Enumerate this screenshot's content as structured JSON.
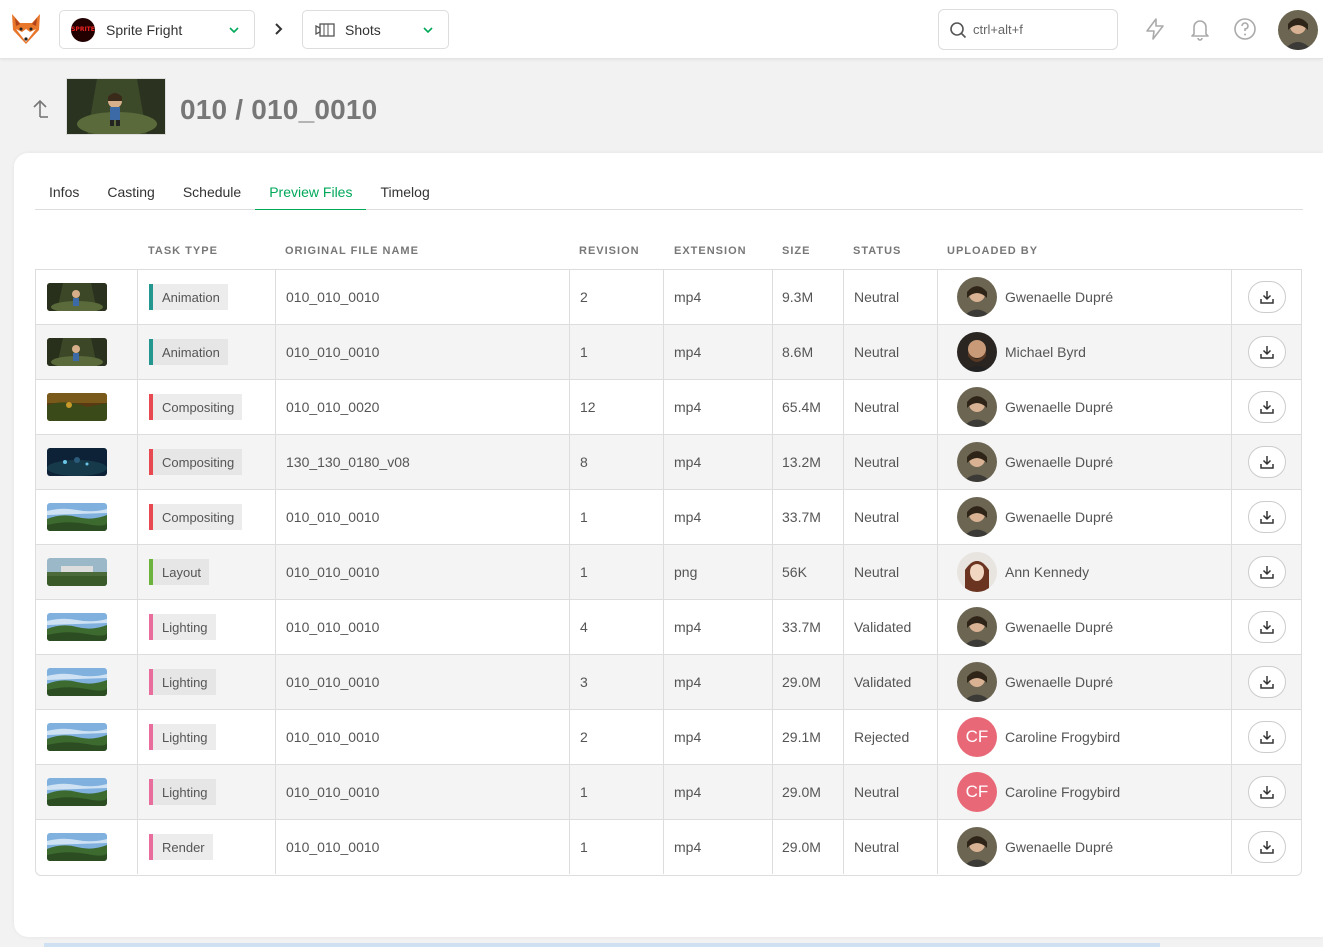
{
  "header": {
    "production": "Sprite Fright",
    "production_badge": "SPRITE",
    "section": "Shots",
    "search_placeholder": "ctrl+alt+f"
  },
  "page": {
    "title": "010 / 010_0010"
  },
  "tabs": [
    {
      "label": "Infos",
      "active": false
    },
    {
      "label": "Casting",
      "active": false
    },
    {
      "label": "Schedule",
      "active": false
    },
    {
      "label": "Preview Files",
      "active": true
    },
    {
      "label": "Timelog",
      "active": false
    }
  ],
  "table": {
    "columns": {
      "task_type": "TASK TYPE",
      "file_name": "ORIGINAL FILE NAME",
      "revision": "REVISION",
      "extension": "EXTENSION",
      "size": "SIZE",
      "status": "STATUS",
      "uploaded_by": "UPLOADED BY"
    },
    "rows": [
      {
        "task": "Animation",
        "task_color": "#22968f",
        "file": "010_010_0010",
        "revision": "2",
        "ext": "mp4",
        "size": "9.3M",
        "status": "Neutral",
        "user": "Gwenaelle Dupré",
        "avatar": "photo-gd",
        "thumb": "forest-character"
      },
      {
        "task": "Animation",
        "task_color": "#22968f",
        "file": "010_010_0010",
        "revision": "1",
        "ext": "mp4",
        "size": "8.6M",
        "status": "Neutral",
        "user": "Michael Byrd",
        "avatar": "photo-mb",
        "thumb": "forest-character"
      },
      {
        "task": "Compositing",
        "task_color": "#e8484f",
        "file": "010_010_0020",
        "revision": "12",
        "ext": "mp4",
        "size": "65.4M",
        "status": "Neutral",
        "user": "Gwenaelle Dupré",
        "avatar": "photo-gd",
        "thumb": "forest-warm"
      },
      {
        "task": "Compositing",
        "task_color": "#e8484f",
        "file": "130_130_0180_v08",
        "revision": "8",
        "ext": "mp4",
        "size": "13.2M",
        "status": "Neutral",
        "user": "Gwenaelle Dupré",
        "avatar": "photo-gd",
        "thumb": "night-blue"
      },
      {
        "task": "Compositing",
        "task_color": "#e8484f",
        "file": "010_010_0010",
        "revision": "1",
        "ext": "mp4",
        "size": "33.7M",
        "status": "Neutral",
        "user": "Gwenaelle Dupré",
        "avatar": "photo-gd",
        "thumb": "landscape"
      },
      {
        "task": "Layout",
        "task_color": "#6cb33e",
        "file": "010_010_0010",
        "revision": "1",
        "ext": "png",
        "size": "56K",
        "status": "Neutral",
        "user": "Ann Kennedy",
        "avatar": "photo-ak",
        "thumb": "layout"
      },
      {
        "task": "Lighting",
        "task_color": "#e86d9d",
        "file": "010_010_0010",
        "revision": "4",
        "ext": "mp4",
        "size": "33.7M",
        "status": "Validated",
        "user": "Gwenaelle Dupré",
        "avatar": "photo-gd",
        "thumb": "landscape"
      },
      {
        "task": "Lighting",
        "task_color": "#e86d9d",
        "file": "010_010_0010",
        "revision": "3",
        "ext": "mp4",
        "size": "29.0M",
        "status": "Validated",
        "user": "Gwenaelle Dupré",
        "avatar": "photo-gd",
        "thumb": "landscape"
      },
      {
        "task": "Lighting",
        "task_color": "#e86d9d",
        "file": "010_010_0010",
        "revision": "2",
        "ext": "mp4",
        "size": "29.1M",
        "status": "Rejected",
        "user": "Caroline Frogybird",
        "avatar": "initials",
        "initials": "CF",
        "thumb": "landscape"
      },
      {
        "task": "Lighting",
        "task_color": "#e86d9d",
        "file": "010_010_0010",
        "revision": "1",
        "ext": "mp4",
        "size": "29.0M",
        "status": "Neutral",
        "user": "Caroline Frogybird",
        "avatar": "initials",
        "initials": "CF",
        "thumb": "landscape"
      },
      {
        "task": "Render",
        "task_color": "#e86d9d",
        "file": "010_010_0010",
        "revision": "1",
        "ext": "mp4",
        "size": "29.0M",
        "status": "Neutral",
        "user": "Gwenaelle Dupré",
        "avatar": "photo-gd",
        "thumb": "landscape"
      }
    ]
  },
  "icons": {
    "logo": "kitsu-fox-logo",
    "back": "back-arrow-icon",
    "search": "search-icon",
    "news": "lightning-icon",
    "notifications": "bell-icon",
    "help": "help-icon",
    "download": "download-icon"
  },
  "colors": {
    "accent": "#00a85a",
    "animation": "#22968f",
    "compositing": "#e8484f",
    "layout": "#6cb33e",
    "lighting": "#e86d9d",
    "initials_avatar": "#e86877"
  }
}
